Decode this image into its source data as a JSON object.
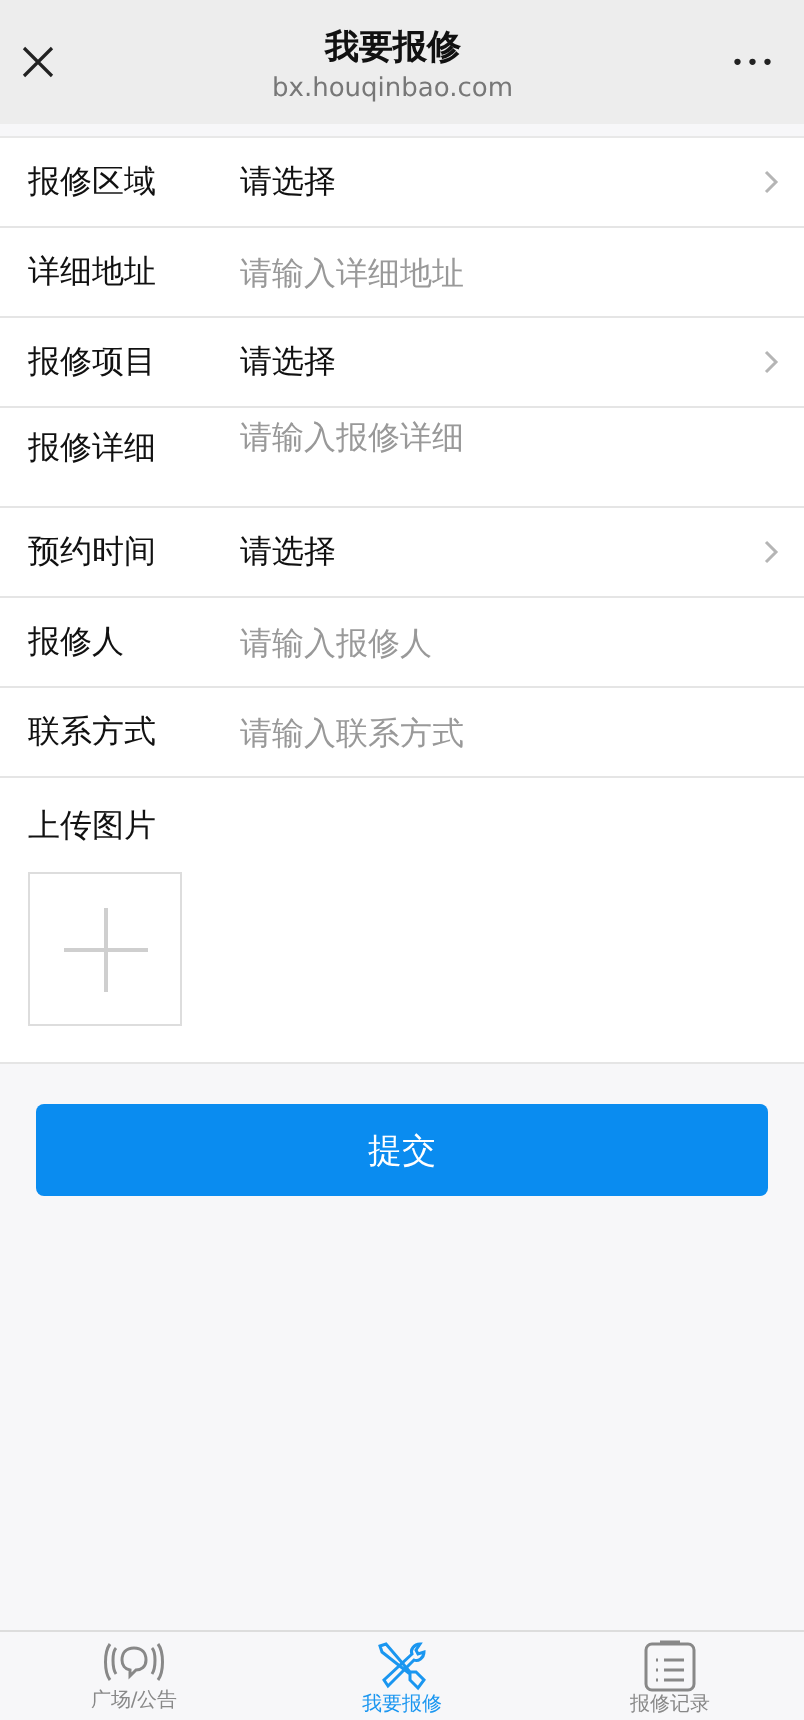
{
  "header": {
    "title": "我要报修",
    "subtitle": "bx.houqinbao.com",
    "more": "•••"
  },
  "fields": [
    {
      "kind": "select",
      "label": "报修区域",
      "value": "请选择"
    },
    {
      "kind": "input",
      "label": "详细地址",
      "placeholder": "请输入详细地址"
    },
    {
      "kind": "select",
      "label": "报修项目",
      "value": "请选择"
    },
    {
      "kind": "textarea",
      "label": "报修详细",
      "placeholder": "请输入报修详细"
    },
    {
      "kind": "select",
      "label": "预约时间",
      "value": "请选择"
    },
    {
      "kind": "input",
      "label": "报修人",
      "placeholder": "请输入报修人"
    },
    {
      "kind": "input",
      "label": "联系方式",
      "placeholder": "请输入联系方式"
    }
  ],
  "upload": {
    "label": "上传图片"
  },
  "submit": "提交",
  "tabs": [
    {
      "kind": "broadcast",
      "label": "广场/公告",
      "selected": false
    },
    {
      "kind": "tools",
      "label": "我要报修",
      "selected": true
    },
    {
      "kind": "list",
      "label": "报修记录",
      "selected": false
    }
  ]
}
